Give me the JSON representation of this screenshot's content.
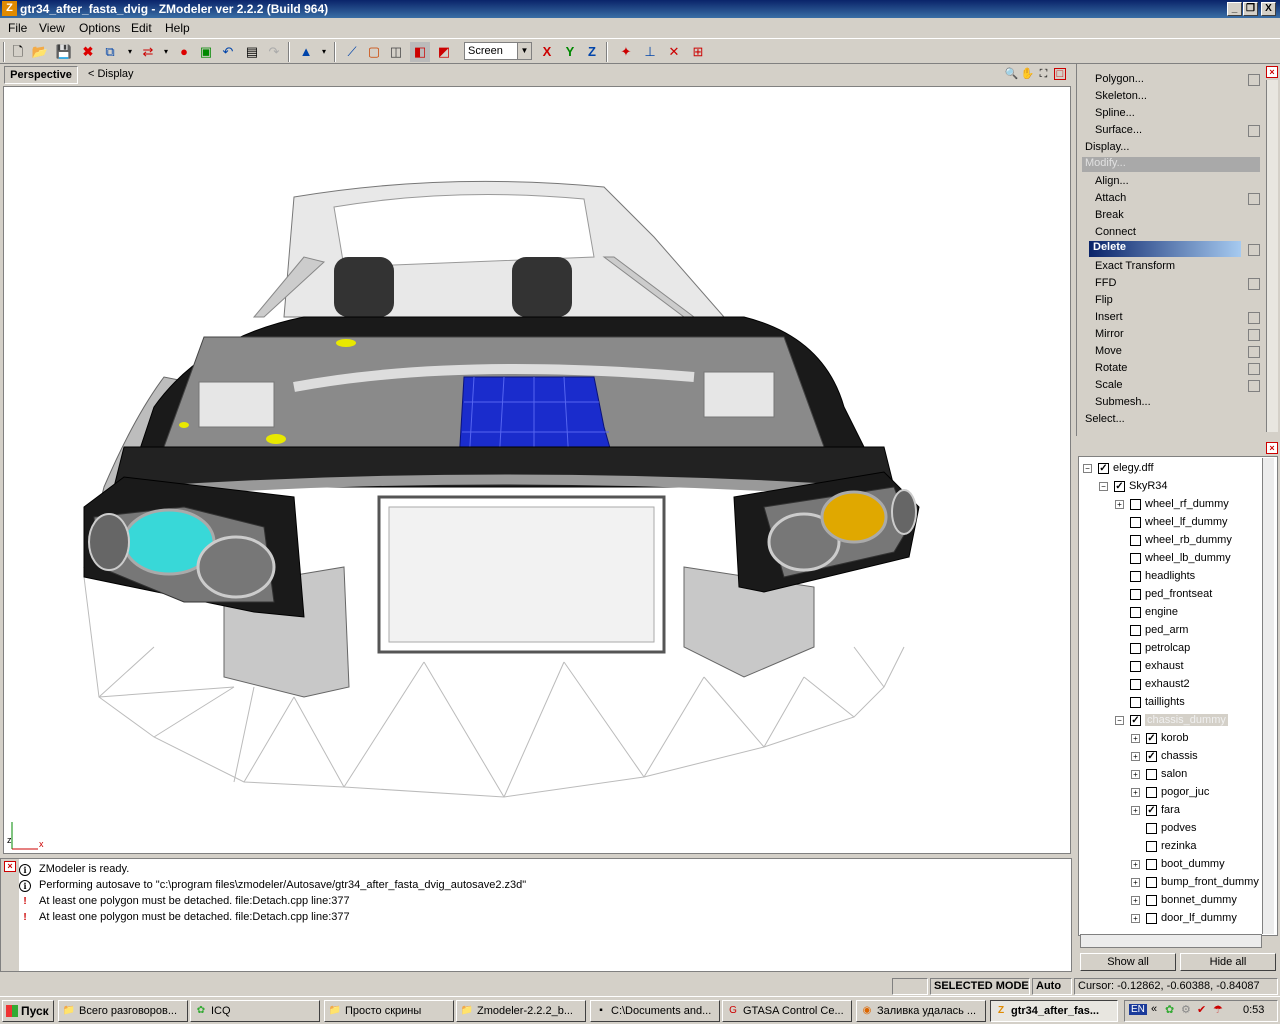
{
  "window": {
    "title": "gtr34_after_fasta_dvig - ZModeler ver 2.2.2 (Build 964)",
    "app_icon": "Z",
    "controls": [
      "_",
      "❐",
      "X"
    ]
  },
  "menu": [
    "File",
    "View",
    "Options",
    "Edit",
    "Help"
  ],
  "toolbar": {
    "view_mode": "Screen",
    "axis_labels": [
      "X",
      "Y",
      "Z"
    ],
    "icons": [
      "new-icon",
      "open-icon",
      "save-icon",
      "delete-icon",
      "undo-icon",
      "redo-icon",
      "select-icon",
      "camera-icon",
      "axis-icon"
    ]
  },
  "viewport": {
    "name": "Perspective",
    "display": "<  Display",
    "axis_z": "z",
    "axis_x": "x"
  },
  "command_panel": {
    "items": [
      {
        "label": "Polygon...",
        "indent": 1,
        "box": true
      },
      {
        "label": "Skeleton...",
        "indent": 1,
        "box": false
      },
      {
        "label": "Spline...",
        "indent": 1,
        "box": false
      },
      {
        "label": "Surface...",
        "indent": 1,
        "box": true
      },
      {
        "label": "Display...",
        "indent": 0,
        "box": false
      },
      {
        "label": "Modify...",
        "indent": 0,
        "box": false,
        "disabled": true
      },
      {
        "label": "Align...",
        "indent": 1,
        "box": false
      },
      {
        "label": "Attach",
        "indent": 1,
        "box": true
      },
      {
        "label": "Break",
        "indent": 1,
        "box": false
      },
      {
        "label": "Connect",
        "indent": 1,
        "box": false
      },
      {
        "label": "Delete",
        "indent": 1,
        "box": true,
        "selected": true
      },
      {
        "label": "Exact Transform",
        "indent": 1,
        "box": false
      },
      {
        "label": "FFD",
        "indent": 1,
        "box": true
      },
      {
        "label": "Flip",
        "indent": 1,
        "box": false
      },
      {
        "label": "Insert",
        "indent": 1,
        "box": true
      },
      {
        "label": "Mirror",
        "indent": 1,
        "box": true
      },
      {
        "label": "Move",
        "indent": 1,
        "box": true
      },
      {
        "label": "Rotate",
        "indent": 1,
        "box": true
      },
      {
        "label": "Scale",
        "indent": 1,
        "box": true
      },
      {
        "label": "Submesh...",
        "indent": 1,
        "box": false
      },
      {
        "label": "Select...",
        "indent": 0,
        "box": false
      }
    ]
  },
  "tree": {
    "rows": [
      {
        "label": "elegy.dff",
        "level": 0,
        "expander": "−",
        "checked": true
      },
      {
        "label": "SkyR34",
        "level": 1,
        "expander": "−",
        "checked": true
      },
      {
        "label": "wheel_rf_dummy",
        "level": 2,
        "expander": "+",
        "checked": false
      },
      {
        "label": "wheel_lf_dummy",
        "level": 2,
        "expander": "",
        "checked": false
      },
      {
        "label": "wheel_rb_dummy",
        "level": 2,
        "expander": "",
        "checked": false
      },
      {
        "label": "wheel_lb_dummy",
        "level": 2,
        "expander": "",
        "checked": false
      },
      {
        "label": "headlights",
        "level": 2,
        "expander": "",
        "checked": false
      },
      {
        "label": "ped_frontseat",
        "level": 2,
        "expander": "",
        "checked": false
      },
      {
        "label": "engine",
        "level": 2,
        "expander": "",
        "checked": false
      },
      {
        "label": "ped_arm",
        "level": 2,
        "expander": "",
        "checked": false
      },
      {
        "label": "petrolcap",
        "level": 2,
        "expander": "",
        "checked": false
      },
      {
        "label": "exhaust",
        "level": 2,
        "expander": "",
        "checked": false
      },
      {
        "label": "exhaust2",
        "level": 2,
        "expander": "",
        "checked": false
      },
      {
        "label": "taillights",
        "level": 2,
        "expander": "",
        "checked": false
      },
      {
        "label": "chassis_dummy",
        "level": 2,
        "expander": "−",
        "checked": true,
        "selected": true
      },
      {
        "label": "korob",
        "level": 3,
        "expander": "+",
        "checked": true
      },
      {
        "label": "chassis",
        "level": 3,
        "expander": "+",
        "checked": true
      },
      {
        "label": "salon",
        "level": 3,
        "expander": "+",
        "checked": false
      },
      {
        "label": "pogor_juc",
        "level": 3,
        "expander": "+",
        "checked": false
      },
      {
        "label": "fara",
        "level": 3,
        "expander": "+",
        "checked": true
      },
      {
        "label": "podves",
        "level": 3,
        "expander": "",
        "checked": false
      },
      {
        "label": "rezinka",
        "level": 3,
        "expander": "",
        "checked": false
      },
      {
        "label": "boot_dummy",
        "level": 3,
        "expander": "+",
        "checked": false
      },
      {
        "label": "bump_front_dummy",
        "level": 3,
        "expander": "+",
        "checked": false
      },
      {
        "label": "bonnet_dummy",
        "level": 3,
        "expander": "+",
        "checked": false
      },
      {
        "label": "door_lf_dummy",
        "level": 3,
        "expander": "+",
        "checked": false
      }
    ],
    "show_all": "Show all",
    "hide_all": "Hide all"
  },
  "log": [
    {
      "icon": "info",
      "text": "ZModeler is ready."
    },
    {
      "icon": "info",
      "text": "Performing autosave to \"c:\\program files\\zmodeler/Autosave/gtr34_after_fasta_dvig_autosave2.z3d\""
    },
    {
      "icon": "warning",
      "text": "At least one polygon must be detached. file:Detach.cpp line:377"
    },
    {
      "icon": "warning",
      "text": "At least one polygon must be detached. file:Detach.cpp line:377"
    }
  ],
  "status": {
    "mode": "SELECTED MODE",
    "auto": "Auto",
    "cursor": "Cursor: -0.12862, -0.60388, -0.84087"
  },
  "taskbar": {
    "start": "Пуск",
    "tasks": [
      {
        "label": "Всего разговоров...",
        "icon": "folder-icon"
      },
      {
        "label": "ICQ",
        "icon": "icq-icon"
      },
      {
        "label": "Просто скрины",
        "icon": "folder-icon"
      },
      {
        "label": "Zmodeler-2.2.2_b...",
        "icon": "folder-icon"
      },
      {
        "label": "C:\\Documents and...",
        "icon": "console-icon"
      },
      {
        "label": "GTASA Control Ce...",
        "icon": "gtasa-icon"
      },
      {
        "label": "Заливка удалась ...",
        "icon": "firefox-icon"
      },
      {
        "label": "gtr34_after_fas...",
        "icon": "zmodeler-icon",
        "active": true
      }
    ],
    "lang": "EN",
    "clock": "0:53"
  },
  "colors": {
    "titlebar": "#0a246a",
    "selection": "#0a246a",
    "engine_blue": "#1a2ccc",
    "headlight_cyan": "#38d8d8",
    "headlight_amber": "#e0a800"
  }
}
